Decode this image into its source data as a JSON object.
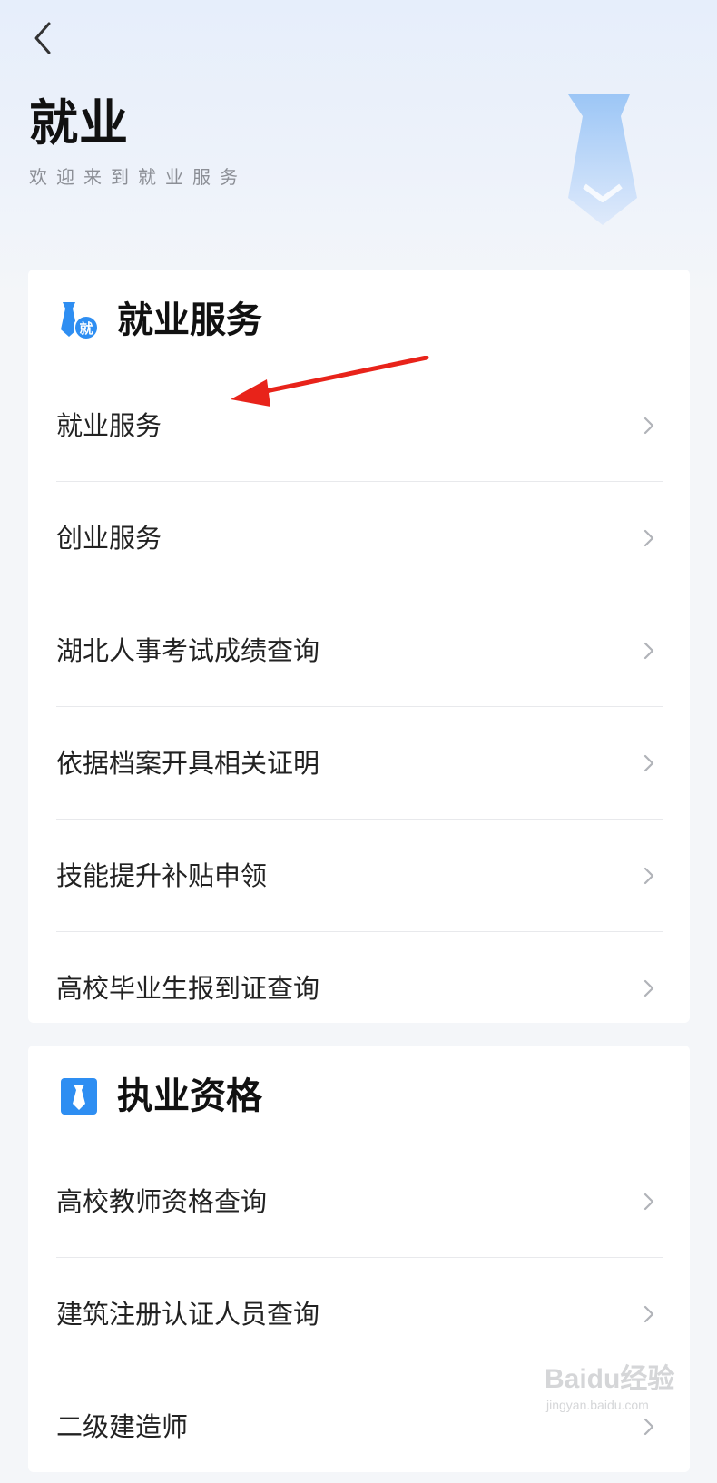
{
  "header": {
    "title": "就业",
    "subtitle": "欢迎来到就业服务"
  },
  "sections": [
    {
      "title": "就业服务",
      "icon_text": "就",
      "items": [
        {
          "label": "就业服务"
        },
        {
          "label": "创业服务"
        },
        {
          "label": "湖北人事考试成绩查询"
        },
        {
          "label": "依据档案开具相关证明"
        },
        {
          "label": "技能提升补贴申领"
        },
        {
          "label": "高校毕业生报到证查询"
        }
      ]
    },
    {
      "title": "执业资格",
      "items": [
        {
          "label": "高校教师资格查询"
        },
        {
          "label": "建筑注册认证人员查询"
        },
        {
          "label": "二级建造师"
        }
      ]
    }
  ],
  "watermark": {
    "logo": "Baidu经验",
    "url": "jingyan.baidu.com"
  },
  "colors": {
    "accent_blue": "#2e8ef2",
    "annotation_red": "#e8231a",
    "tie_light": "#b7d4f8"
  }
}
